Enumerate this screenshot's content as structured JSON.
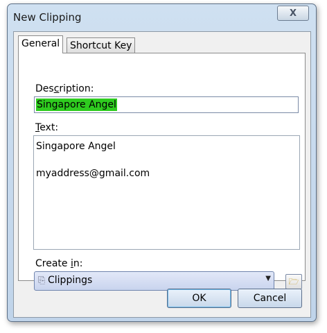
{
  "dialog": {
    "title": "New Clipping",
    "close_label": "X"
  },
  "tabs": [
    {
      "label": "General",
      "active": true
    },
    {
      "label": "Shortcut Key",
      "active": false
    }
  ],
  "description": {
    "label_prefix": "Des",
    "label_key": "c",
    "label_suffix": "ription:",
    "value": "Singapore Angel"
  },
  "text": {
    "label_key": "T",
    "label_suffix": "ext:",
    "lines": [
      "Singapore Angel",
      "myaddress@gmail.com"
    ]
  },
  "create_in": {
    "label_prefix": "Create ",
    "label_key": "i",
    "label_suffix": "n:",
    "selected": "Clippings",
    "icon": "clippings-icon"
  },
  "buttons": {
    "ok": "OK",
    "cancel": "Cancel"
  },
  "colors": {
    "selection_highlight": "#2ecc1f",
    "window_frame": "#c0d4ea"
  }
}
